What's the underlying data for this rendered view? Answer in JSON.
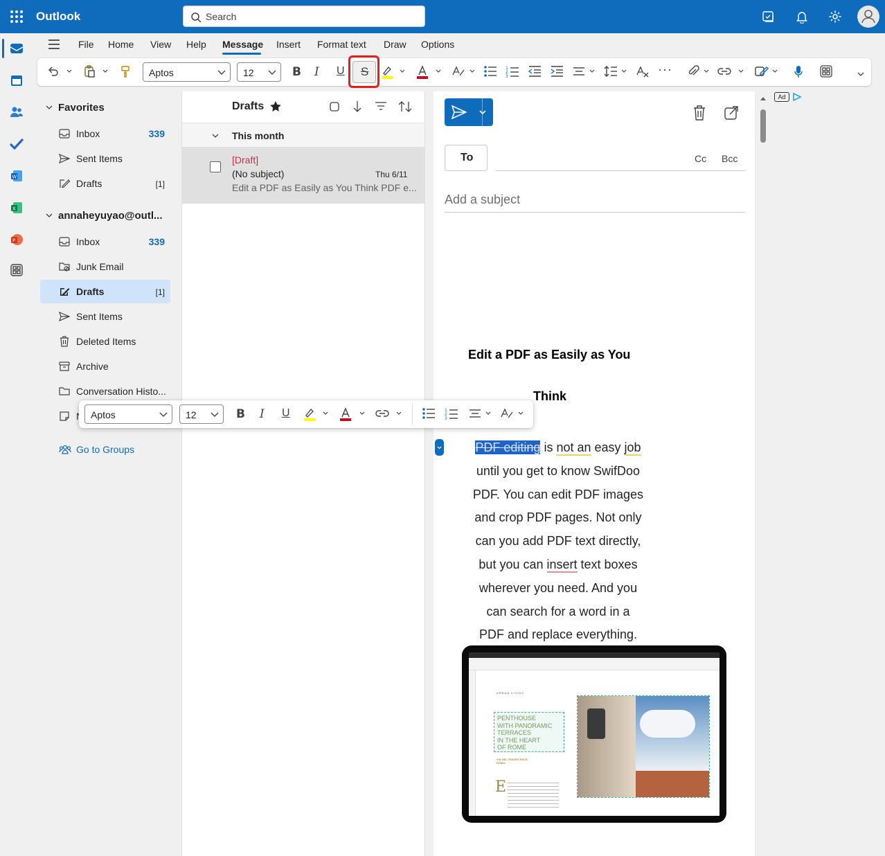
{
  "app": {
    "title": "Outlook"
  },
  "search": {
    "placeholder": "Search"
  },
  "ribbon": {
    "tabs": [
      "File",
      "Home",
      "View",
      "Help",
      "Message",
      "Insert",
      "Format text",
      "Draw",
      "Options"
    ],
    "active_tab": "Message",
    "font_name": "Aptos",
    "font_size": "12",
    "more_label": "···"
  },
  "folders": {
    "favorites_label": "Favorites",
    "favorites": [
      {
        "label": "Inbox",
        "count": "339"
      },
      {
        "label": "Sent Items",
        "count": ""
      },
      {
        "label": "Drafts",
        "count": "[1]"
      }
    ],
    "account_label": "annaheyuyao@outl...",
    "account_items": [
      {
        "label": "Inbox",
        "count": "339"
      },
      {
        "label": "Junk Email",
        "count": ""
      },
      {
        "label": "Drafts",
        "count": "[1]"
      },
      {
        "label": "Sent Items",
        "count": ""
      },
      {
        "label": "Deleted Items",
        "count": ""
      },
      {
        "label": "Archive",
        "count": ""
      },
      {
        "label": "Conversation Histo...",
        "count": ""
      },
      {
        "label": "N",
        "count": ""
      }
    ],
    "groups_link": "Go to Groups"
  },
  "message_list": {
    "title": "Drafts",
    "section": "This month",
    "items": [
      {
        "tag": "[Draft]",
        "subject": "(No subject)",
        "date": "Thu 6/11",
        "preview": "Edit a PDF as Easily as You Think PDF e..."
      }
    ]
  },
  "compose": {
    "to_label": "To",
    "cc_label": "Cc",
    "bcc_label": "Bcc",
    "subject_placeholder": "Add a subject",
    "doc_title_line1": "Edit a PDF as Easily as You",
    "doc_title_line2": "Think",
    "body_selected": "PDF editing",
    "body": [
      " is ",
      "not an",
      " easy ",
      "job",
      "until you get to know SwifDoo",
      "PDF. You can edit PDF images",
      "and crop PDF pages. Not only",
      "can you add PDF text directly,",
      "but you can ",
      "insert",
      " text boxes",
      "wherever you need. And you",
      "can search for a word in a",
      "PDF and replace everything."
    ]
  },
  "floating_toolbar": {
    "font_name": "Aptos",
    "font_size": "12"
  },
  "ad": {
    "label": "Ad"
  },
  "image_mock": {
    "header": "URBAN LIVING",
    "headline": [
      "PENTHOUSE",
      "WITH PANORAMIC",
      "TERRACES",
      "IN THE HEART",
      "OF ROME"
    ],
    "address": [
      "VIA DEL TEATRO PACE,",
      "ROMA"
    ],
    "dropcap": "E"
  },
  "colors": {
    "brand": "#0f6cbd",
    "draft_tag": "#c4314b",
    "highlight_red": "#e02020",
    "selection": "#1e63c8"
  }
}
